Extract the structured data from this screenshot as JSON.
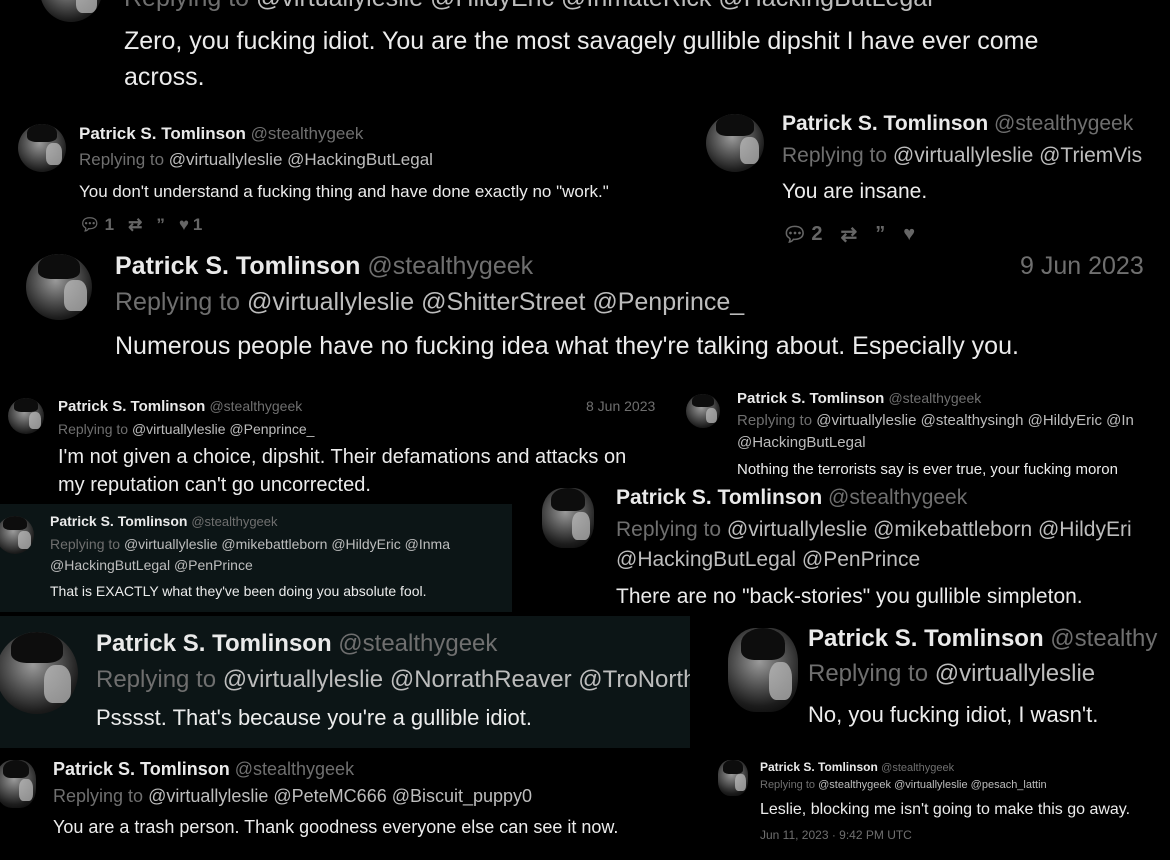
{
  "tweets": [
    {
      "replying_prefix": "Replying to",
      "replying_to": "@virtuallyleslie @HildyEric @InmateRick @HackingButLegal",
      "body_line1": "Zero, you fucking idiot. You are the most savagely gullible dipshit I have ever come",
      "body_line2": "across."
    },
    {
      "name": "Patrick S. Tomlinson",
      "handle": "@stealthygeek",
      "replying_prefix": "Replying to",
      "replying_to": "@virtuallyleslie @HackingButLegal",
      "body": "You don't understand a fucking thing and have done exactly no \"work.\"",
      "reply_count": "1",
      "like_count": "1"
    },
    {
      "name": "Patrick S. Tomlinson",
      "handle": "@stealthygeek",
      "replying_prefix": "Replying to",
      "replying_to": "@virtuallyleslie @TriemVis",
      "body": "You are insane.",
      "reply_count": "2"
    },
    {
      "name": "Patrick S. Tomlinson",
      "handle": "@stealthygeek",
      "date": "9 Jun 2023",
      "replying_prefix": "Replying to",
      "replying_to": "@virtuallyleslie @ShitterStreet @Penprince_",
      "body": "Numerous people have no fucking idea what they're talking about. Especially you."
    },
    {
      "name": "Patrick S. Tomlinson",
      "handle": "@stealthygeek",
      "date": "8 Jun 2023",
      "replying_prefix": "Replying to",
      "replying_to": "@virtuallyleslie @Penprince_",
      "body_line1": "I'm not given a choice, dipshit. Their defamations and attacks on",
      "body_line2": "my reputation can't go uncorrected."
    },
    {
      "name": "Patrick S. Tomlinson",
      "handle": "@stealthygeek",
      "replying_prefix": "Replying to",
      "replying_to": "@virtuallyleslie @stealthysingh @HildyEric @In",
      "replying_to_line2": "@HackingButLegal",
      "body": "Nothing the terrorists say is ever true, your fucking moron"
    },
    {
      "name": "Patrick S. Tomlinson",
      "handle": "@stealthygeek",
      "replying_prefix": "Replying to",
      "replying_to": "@virtuallyleslie @mikebattleborn @HildyEric @Inma",
      "replying_to_line2": "@HackingButLegal @PenPrince",
      "body": "That is EXACTLY what they've been doing you absolute fool."
    },
    {
      "name": "Patrick S. Tomlinson",
      "handle": "@stealthygeek",
      "replying_prefix": "Replying to",
      "replying_to": "@virtuallyleslie @mikebattleborn @HildyEri",
      "replying_to_line2": "@HackingButLegal @PenPrince",
      "body": "There are no \"back-stories\" you gullible simpleton."
    },
    {
      "name": "Patrick S. Tomlinson",
      "handle": "@stealthygeek",
      "replying_prefix": "Replying to",
      "replying_to": "@virtuallyleslie @NorrathReaver @TroNorth",
      "body": "Psssst. That's because you're a gullible idiot."
    },
    {
      "name": "Patrick S. Tomlinson",
      "handle": "@stealthy",
      "replying_prefix": "Replying to",
      "replying_to": "@virtuallyleslie",
      "body": "No, you fucking idiot, I wasn't."
    },
    {
      "name": "Patrick S. Tomlinson",
      "handle": "@stealthygeek",
      "replying_prefix": "Replying to",
      "replying_to": "@virtuallyleslie @PeteMC666 @Biscuit_puppy0",
      "body": "You are a trash person. Thank goodness everyone else can see it now."
    },
    {
      "name": "Patrick S. Tomlinson",
      "handle": "@stealthygeek",
      "replying_prefix": "Replying to",
      "replying_to": "@stealthygeek @virtuallyleslie @pesach_lattin",
      "body": "Leslie, blocking me isn't going to make this go away.",
      "timestamp": "Jun 11, 2023 · 9:42 PM UTC"
    }
  ],
  "icons": {
    "reply": "reply-icon",
    "retweet": "retweet-icon",
    "quote": "quote-icon",
    "like": "heart-icon"
  }
}
